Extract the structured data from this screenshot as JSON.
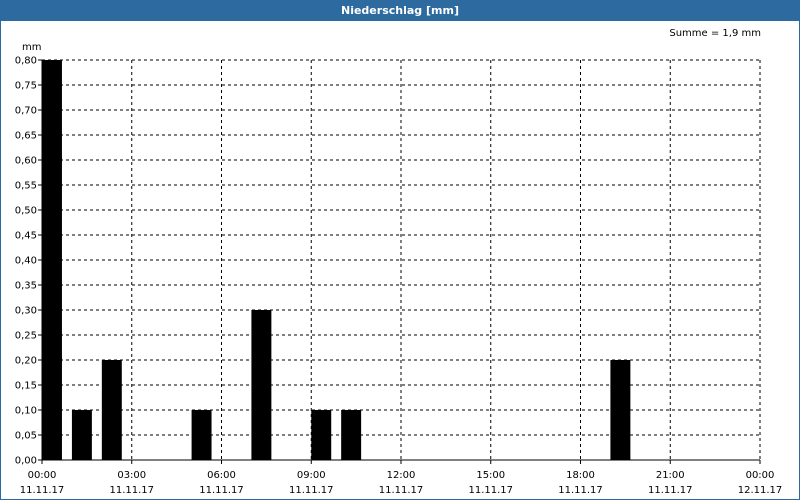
{
  "window": {
    "title": "Niederschlag [mm]"
  },
  "chart_data": {
    "type": "bar",
    "title": "Niederschlag [mm]",
    "ylabel": "mm",
    "annotation": "Summe = 1,9 mm",
    "ylim": [
      0,
      0.8
    ],
    "yticks": [
      "0,00",
      "0,05",
      "0,10",
      "0,15",
      "0,20",
      "0,25",
      "0,30",
      "0,35",
      "0,40",
      "0,45",
      "0,50",
      "0,55",
      "0,60",
      "0,65",
      "0,70",
      "0,75",
      "0,80"
    ],
    "xlim_hours": [
      0,
      24
    ],
    "xticks": [
      {
        "time": "00:00",
        "date": "11.11.17"
      },
      {
        "time": "03:00",
        "date": "11.11.17"
      },
      {
        "time": "06:00",
        "date": "11.11.17"
      },
      {
        "time": "09:00",
        "date": "11.11.17"
      },
      {
        "time": "12:00",
        "date": "11.11.17"
      },
      {
        "time": "15:00",
        "date": "11.11.17"
      },
      {
        "time": "18:00",
        "date": "11.11.17"
      },
      {
        "time": "21:00",
        "date": "11.11.17"
      },
      {
        "time": "00:00",
        "date": "12.11.17"
      }
    ],
    "bar_color": "#000000",
    "grid": true,
    "bars": [
      {
        "start_hour": 0,
        "end_hour": 0.667,
        "value": 0.8
      },
      {
        "start_hour": 1,
        "end_hour": 1.667,
        "value": 0.1
      },
      {
        "start_hour": 2,
        "end_hour": 2.667,
        "value": 0.2
      },
      {
        "start_hour": 5,
        "end_hour": 5.667,
        "value": 0.1
      },
      {
        "start_hour": 7,
        "end_hour": 7.667,
        "value": 0.3
      },
      {
        "start_hour": 9,
        "end_hour": 9.667,
        "value": 0.1
      },
      {
        "start_hour": 10,
        "end_hour": 10.667,
        "value": 0.1
      },
      {
        "start_hour": 19,
        "end_hour": 19.667,
        "value": 0.2
      }
    ]
  }
}
